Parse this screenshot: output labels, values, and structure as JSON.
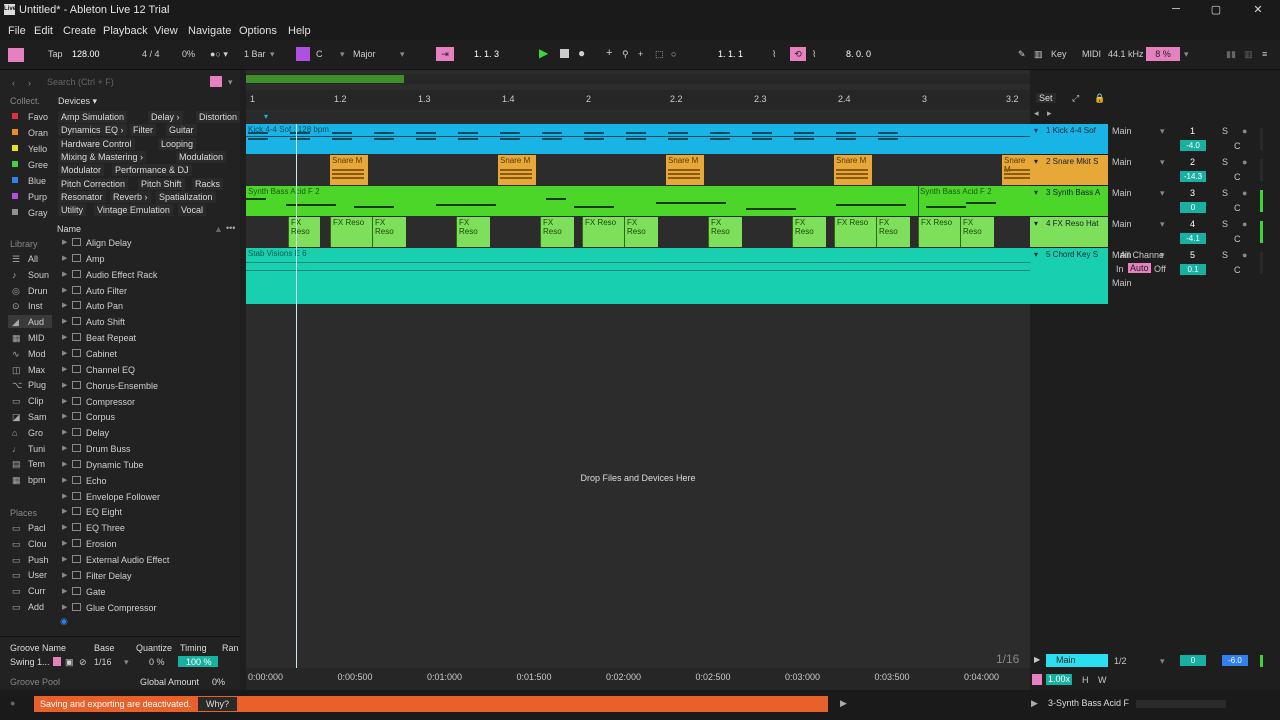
{
  "window": {
    "title": "Untitled* - Ableton Live 12 Trial",
    "logo_text": "Live",
    "minimize": "─",
    "maximize": "▢",
    "close": "✕"
  },
  "menu": [
    "File",
    "Edit",
    "Create",
    "Playback",
    "View",
    "Navigate",
    "Options",
    "Help"
  ],
  "control": {
    "tap": "Tap",
    "tempo": "128.00",
    "signature": "4 / 4",
    "groove_pct": "0%",
    "quantize": "1 Bar",
    "key_root": "C",
    "scale": "Major",
    "arrangement_position": "1.  1.  3",
    "loop_start": "1.  1.  1",
    "loop_length": "8.  0.  0",
    "key_label": "Key",
    "midi_label": "MIDI",
    "sample_rate": "44.1 kHz",
    "cpu": "8 %"
  },
  "browser": {
    "search_placeholder": "Search (Ctrl + F)",
    "collections_label": "Collect.",
    "collections": [
      {
        "label": "Favo",
        "color": "#e0303a"
      },
      {
        "label": "Oran",
        "color": "#f08a20"
      },
      {
        "label": "Yello",
        "color": "#e8e020"
      },
      {
        "label": "Gree",
        "color": "#40d040"
      },
      {
        "label": "Blue",
        "color": "#3080f0"
      },
      {
        "label": "Purp",
        "color": "#b050e0"
      },
      {
        "label": "Gray",
        "color": "#909090"
      }
    ],
    "devices_label": "Devices ▾",
    "categories": [
      [
        "Amp Simulation",
        "Delay ›",
        "Distortion"
      ],
      [
        "Dynamics",
        "EQ ›",
        "Filter",
        "Guitar"
      ],
      [
        "Hardware Control",
        "Looping"
      ],
      [
        "Mixing & Mastering ›",
        "Modulation"
      ],
      [
        "Modulator",
        "Performance & DJ"
      ],
      [
        "Pitch Correction",
        "Pitch Shift",
        "Racks"
      ],
      [
        "Resonator",
        "Reverb ›",
        "Spatialization"
      ],
      [
        "Utility",
        "Vintage Emulation",
        "Vocal"
      ]
    ],
    "library_label": "Library",
    "library": [
      "All",
      "Soun",
      "Drun",
      "Inst",
      "Aud",
      "MID",
      "Mod",
      "Max",
      "Plug",
      "Clip",
      "Sam",
      "Gro",
      "Tuni",
      "Tem",
      "bpm"
    ],
    "places_label": "Places",
    "places": [
      "Pacl",
      "Clou",
      "Push",
      "User",
      "Curr",
      "Add"
    ],
    "name_header": "Name",
    "items": [
      "Align Delay",
      "Amp",
      "Audio Effect Rack",
      "Auto Filter",
      "Auto Pan",
      "Auto Shift",
      "Beat Repeat",
      "Cabinet",
      "Channel EQ",
      "Chorus-Ensemble",
      "Compressor",
      "Corpus",
      "Delay",
      "Drum Buss",
      "Dynamic Tube",
      "Echo",
      "Envelope Follower",
      "EQ Eight",
      "EQ Three",
      "Erosion",
      "External Audio Effect",
      "Filter Delay",
      "Gate",
      "Glue Compressor"
    ]
  },
  "groove": {
    "headers": [
      "Groove Name",
      "Base",
      "Quantize",
      "Timing",
      "Ran"
    ],
    "row": {
      "name": "Swing 1...",
      "base": "1/16",
      "quantize": "0 %",
      "timing": "100 %",
      "timing_fill": 1.0
    },
    "pool_label": "Groove Pool",
    "global_amount_label": "Global Amount",
    "global_amount": "0%"
  },
  "ruler": {
    "bars": [
      "1",
      "1.2",
      "1.3",
      "1.4",
      "2",
      "2.2",
      "2.3",
      "2.4",
      "3",
      "3.2"
    ],
    "set_label": "Set",
    "times": [
      "0:00:000",
      "0:00:500",
      "0:01:000",
      "0:01:500",
      "0:02:000",
      "0:02:500",
      "0:03:000",
      "0:03:500",
      "0:04:000"
    ]
  },
  "tracks": [
    {
      "name": "1 Kick 4-4 Sof",
      "clip": "Kick 4-4 Sof : 128 bpm",
      "color": "#19b4e6",
      "route": "Main",
      "num": "1",
      "vol": "-4.0",
      "pan": "C",
      "solo": "S"
    },
    {
      "name": "2 Snare Mkit S",
      "clip": "Snare M",
      "color": "#e8a838",
      "route": "Main",
      "num": "2",
      "vol": "-14.3",
      "pan": "C",
      "solo": "S"
    },
    {
      "name": "3 Synth Bass A",
      "clip": "Synth Bass Acid F 2",
      "color": "#4cd62a",
      "route": "Main",
      "num": "3",
      "vol": "0",
      "pan": "C",
      "solo": "S"
    },
    {
      "name": "4 FX Reso Hat",
      "clip": "FX Reso",
      "color": "#7ee05a",
      "route": "Main",
      "num": "4",
      "vol": "-4.1",
      "pan": "C",
      "solo": "S"
    },
    {
      "name": "5 Chord Key S",
      "clip": "Stab Visions E 6",
      "color": "#18d0b0",
      "route": "Main",
      "input": "All Channe",
      "monitor_in": "In",
      "monitor_auto": "Auto",
      "monitor_off": "Off",
      "num": "5",
      "vol": "0.1",
      "pan": "C",
      "solo": "S"
    }
  ],
  "drop_hint": "Drop Files and Devices Here",
  "master": {
    "name": "Main",
    "cue": "1/2",
    "vol": "0",
    "vol2": "-6.0",
    "grid": "1/16",
    "zoom": "1.00x",
    "h": "H",
    "w": "W"
  },
  "status": {
    "warning": "Saving and exporting are deactivated.",
    "why": "Why?",
    "selected": "3-Synth Bass Acid F"
  },
  "colors": {
    "accent_pink": "#e680c0",
    "play_green": "#3cd63c",
    "warning_orange": "#e8602a"
  }
}
